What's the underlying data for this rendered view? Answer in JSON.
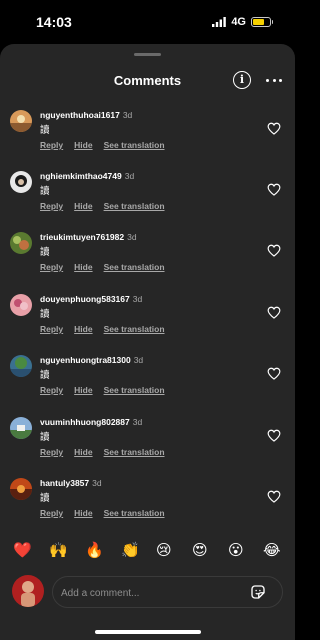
{
  "status_bar": {
    "time": "14:03",
    "network": "4G",
    "battery_level": 0.7
  },
  "sheet": {
    "title": "Comments"
  },
  "comments": [
    {
      "username": "nguyenthuhoai1617",
      "time": "3d",
      "text": "讀",
      "reply": "Reply",
      "hide": "Hide",
      "translate": "See translation"
    },
    {
      "username": "nghiemkimthao4749",
      "time": "3d",
      "text": "讀",
      "reply": "Reply",
      "hide": "Hide",
      "translate": "See translation"
    },
    {
      "username": "trieukimtuyen761982",
      "time": "3d",
      "text": "讀",
      "reply": "Reply",
      "hide": "Hide",
      "translate": "See translation"
    },
    {
      "username": "douyenphuong583167",
      "time": "3d",
      "text": "讀",
      "reply": "Reply",
      "hide": "Hide",
      "translate": "See translation"
    },
    {
      "username": "nguyenhuongtra81300",
      "time": "3d",
      "text": "讀",
      "reply": "Reply",
      "hide": "Hide",
      "translate": "See translation"
    },
    {
      "username": "vuuminhhuong802887",
      "time": "3d",
      "text": "讀",
      "reply": "Reply",
      "hide": "Hide",
      "translate": "See translation"
    },
    {
      "username": "hantuly3857",
      "time": "3d",
      "text": "讀",
      "reply": "Reply",
      "hide": "Hide",
      "translate": "See translation"
    }
  ],
  "emojis": [
    "❤️",
    "🙌",
    "🔥",
    "👏",
    "😢",
    "😍",
    "😮",
    "😂"
  ],
  "composer": {
    "placeholder": "Add a comment..."
  },
  "colors": {
    "sheet_bg": "#262626",
    "muted_text": "#a8a8a8",
    "battery": "#f5d000",
    "heart_emoji": "#e0245e"
  }
}
